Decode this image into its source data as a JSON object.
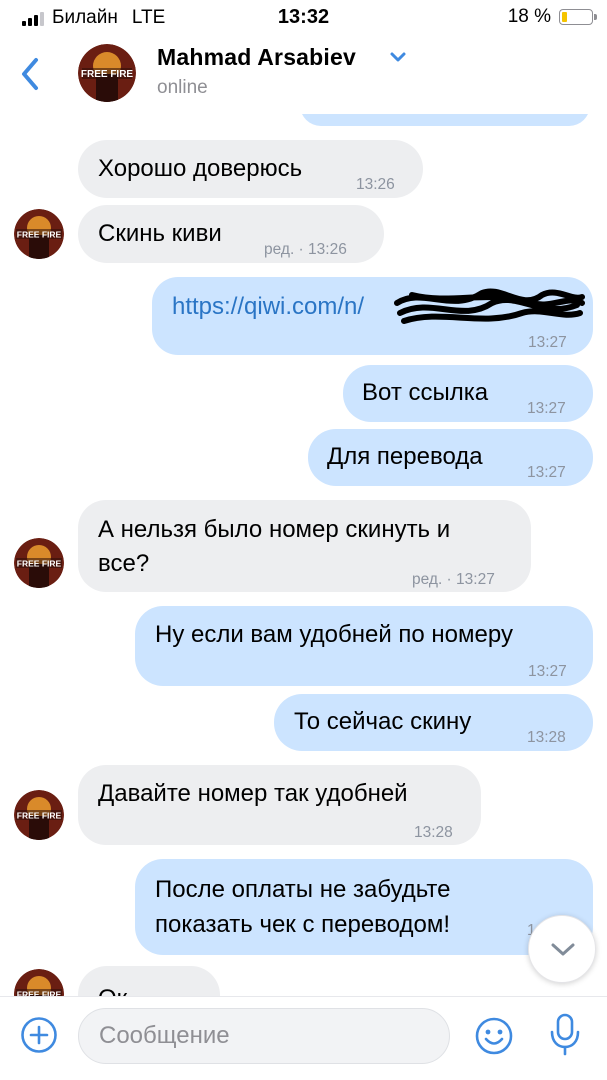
{
  "status_bar": {
    "carrier": "Билайн",
    "network": "LTE",
    "time": "13:32",
    "battery_percent_label": "18 %",
    "battery_level": 0.18
  },
  "header": {
    "peer_name": "Mahmad Arsabiev",
    "peer_status": "online"
  },
  "messages": [
    {
      "side": "in",
      "text": "Хорошо доверюсь",
      "meta": "13:26"
    },
    {
      "side": "in",
      "text": "Скинь киви",
      "meta": "ред. · 13:26"
    },
    {
      "side": "out",
      "text": "https://qiwi.com/n/",
      "meta": "13:27"
    },
    {
      "side": "out",
      "text": "Вот ссылка",
      "meta": "13:27"
    },
    {
      "side": "out",
      "text": "Для перевода",
      "meta": "13:27"
    },
    {
      "side": "in",
      "text_line1": "А нельзя было номер скинуть и",
      "text_line2": "все?",
      "meta": "ред. · 13:27"
    },
    {
      "side": "out",
      "text": "Ну если вам удобней по номеру",
      "meta": "13:27"
    },
    {
      "side": "out",
      "text": "То сейчас скину",
      "meta": "13:28"
    },
    {
      "side": "in",
      "text": "Давайте номер так удобней",
      "meta": "13:28"
    },
    {
      "side": "out",
      "text_line1": "После оплаты не забудьте",
      "text_line2": "показать чек с переводом!",
      "meta": "1"
    },
    {
      "side": "in",
      "text": "Ок",
      "meta": ""
    }
  ],
  "composer": {
    "placeholder": "Сообщение"
  },
  "colors": {
    "incoming_bubble": "#edeef0",
    "outgoing_bubble": "#cce4ff",
    "accent": "#3f8ae0",
    "link": "#2a75c5",
    "meta_text": "#8d94a0"
  },
  "icons": [
    "back-chevron-icon",
    "chevron-down-icon",
    "attach-plus-icon",
    "emoji-icon",
    "microphone-icon",
    "scroll-down-icon"
  ]
}
